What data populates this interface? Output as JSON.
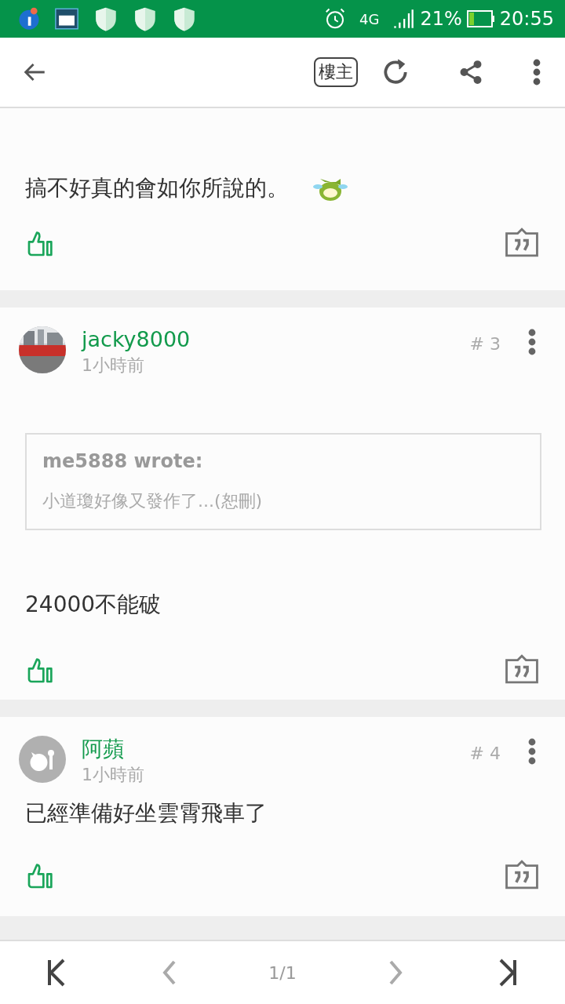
{
  "status_bar": {
    "network": "4G",
    "battery": "21%",
    "time": "20:55"
  },
  "toolbar": {
    "op_label": "樓主"
  },
  "posts": [
    {
      "kind": "partial",
      "body": "搞不好真的會如你所說的。",
      "emoji": true
    },
    {
      "kind": "full",
      "author": "jacky8000",
      "time": "1小時前",
      "floor": "# 3",
      "quote": {
        "author": "me5888 wrote:",
        "text": "小道瓊好像又發作了...(恕刪)"
      },
      "body": "24000不能破"
    },
    {
      "kind": "full",
      "author": "阿蘋",
      "time": "1小時前",
      "floor": "# 4",
      "avatar": {
        "kind": "default"
      },
      "body": "已經準備好坐雲霄飛車了"
    }
  ],
  "pager": {
    "page": "1/1",
    "first_disabled": false,
    "prev_disabled": true,
    "next_disabled": true,
    "last_disabled": false
  }
}
